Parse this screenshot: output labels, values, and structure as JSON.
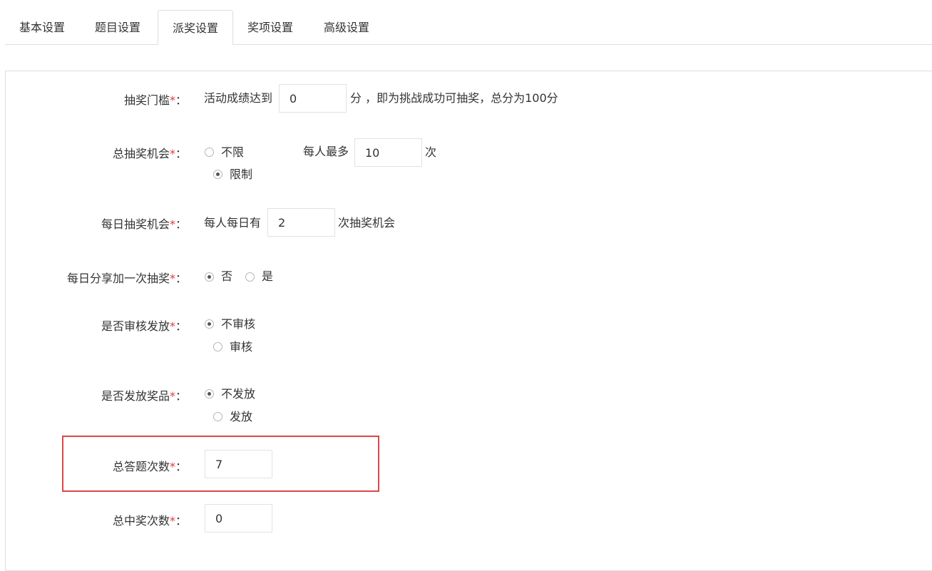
{
  "tabs": [
    "基本设置",
    "题目设置",
    "派奖设置",
    "奖项设置",
    "高级设置"
  ],
  "required_mark": "*",
  "colon": "：",
  "threshold": {
    "label": "抽奖门槛",
    "prefix": "活动成绩达到",
    "value": "0",
    "suffix": "分 ，即为挑战成功可抽奖，总分为100分"
  },
  "total_chances": {
    "label": "总抽奖机会",
    "option_unlimited": "不限",
    "option_limited": "限制",
    "selected": "限制",
    "per_person_prefix": "每人最多",
    "per_person_value": "10",
    "per_person_suffix": "次"
  },
  "daily_chances": {
    "label": "每日抽奖机会",
    "prefix": "每人每日有",
    "value": "2",
    "suffix": "次抽奖机会"
  },
  "daily_share": {
    "label": "每日分享加一次抽奖",
    "option_no": "否",
    "option_yes": "是",
    "selected": "否"
  },
  "audit": {
    "label": "是否审核发放",
    "option_no": "不审核",
    "option_yes": "审核",
    "selected": "不审核"
  },
  "prize_dispatch": {
    "label": "是否发放奖品",
    "option_no": "不发放",
    "option_yes": "发放",
    "selected": "不发放"
  },
  "total_answers": {
    "label": "总答题次数",
    "value": "7"
  },
  "total_wins": {
    "label": "总中奖次数",
    "value": "0"
  },
  "colors": {
    "required": "#e4393c",
    "highlight": "#e04545",
    "border": "#dddddd"
  }
}
